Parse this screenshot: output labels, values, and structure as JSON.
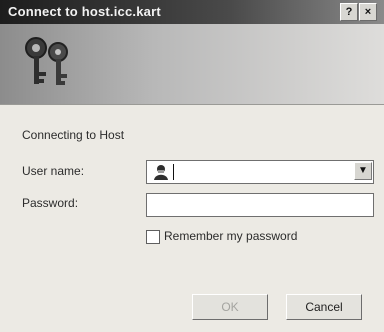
{
  "window": {
    "title": "Connect to host.icc.kart",
    "help_label": "?",
    "close_label": "×"
  },
  "form": {
    "heading": "Connecting to Host",
    "username_label": "User name:",
    "password_label": "Password:",
    "remember_label": "Remember my password"
  },
  "buttons": {
    "ok_label": "OK",
    "cancel_label": "Cancel"
  },
  "icons": {
    "banner": "keys-icon",
    "user": "user-icon",
    "dropdown": "chevron-down-icon"
  }
}
